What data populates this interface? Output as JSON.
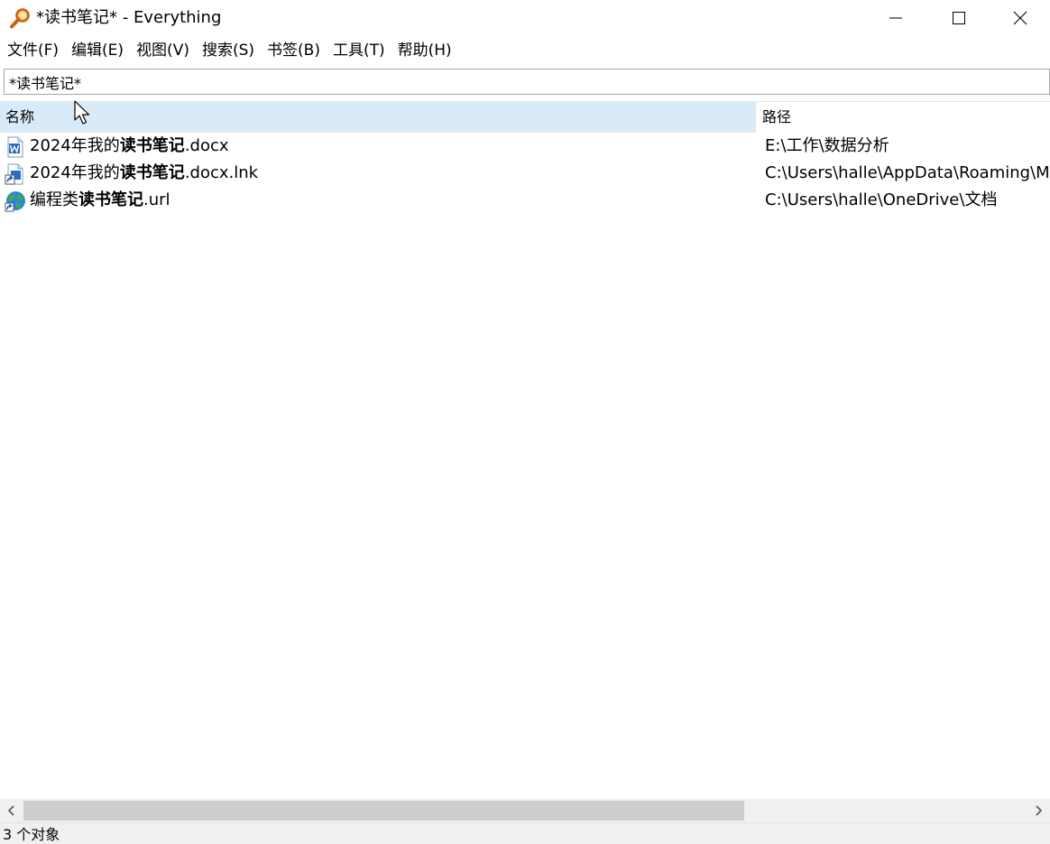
{
  "window": {
    "title": "*读书笔记* - Everything",
    "icon": "magnifier-icon",
    "controls": [
      "minimize-icon",
      "maximize-icon",
      "close-icon"
    ]
  },
  "menu": [
    {
      "label": "文件(F)"
    },
    {
      "label": "编辑(E)"
    },
    {
      "label": "视图(V)"
    },
    {
      "label": "搜索(S)"
    },
    {
      "label": "书签(B)"
    },
    {
      "label": "工具(T)"
    },
    {
      "label": "帮助(H)"
    }
  ],
  "search": {
    "value": "*读书笔记*"
  },
  "columns": {
    "name": "名称",
    "path": "路径"
  },
  "results": [
    {
      "icon": "word-doc-icon",
      "prefix": "2024年我的",
      "match": "读书笔记",
      "suffix": ".docx",
      "path": "E:\\工作\\数据分析"
    },
    {
      "icon": "shortcut-doc-icon",
      "prefix": "2024年我的",
      "match": "读书笔记",
      "suffix": ".docx.lnk",
      "path": "C:\\Users\\halle\\AppData\\Roaming\\Mi"
    },
    {
      "icon": "globe-url-icon",
      "prefix": "编程类",
      "match": "读书笔记",
      "suffix": ".url",
      "path": "C:\\Users\\halle\\OneDrive\\文档"
    }
  ],
  "status": {
    "count_text": "3 个对象"
  },
  "colors": {
    "selected_header": "#d9ebf9",
    "scrollbar_thumb": "#cdcdcd",
    "statusbar_bg": "#f0f0f0"
  }
}
